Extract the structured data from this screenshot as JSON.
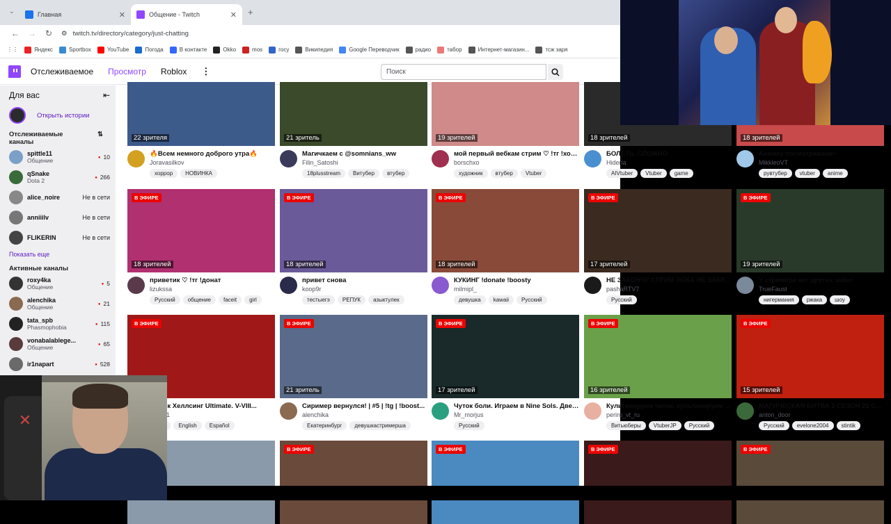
{
  "browser": {
    "tabs": [
      {
        "title": "Главная",
        "color": "#1a73e8"
      },
      {
        "title": "Общение - Twitch",
        "color": "#9146ff"
      }
    ],
    "url": "twitch.tv/directory/category/just-chatting",
    "bookmarks": [
      "Яндекс",
      "Sportbox",
      "YouTube",
      "Погода",
      "В контакте",
      "Okko",
      "mos",
      "госу",
      "Википедия",
      "Google Переводчик",
      "радио",
      "табор",
      "Интернет-магазин...",
      "тсж заря"
    ]
  },
  "topnav": {
    "following": "Отслеживаемое",
    "browse": "Просмотр",
    "roblox": "Roblox",
    "search_placeholder": "Поиск",
    "accent": "#9146ff"
  },
  "sidebar": {
    "for_you": "Для вас",
    "stories": "Открыть истории",
    "followed_title": "Отслеживаемые каналы",
    "followed": [
      {
        "name": "spittle11",
        "sub": "Общение",
        "viewers": "10",
        "color": "#7aa0c8"
      },
      {
        "name": "qSnake",
        "sub": "Dota 2",
        "viewers": "266",
        "color": "#3a6b3a"
      },
      {
        "name": "alice_noire",
        "sub": "",
        "viewers": "Не в сети",
        "color": "#888"
      },
      {
        "name": "anniiilv",
        "sub": "",
        "viewers": "Не в сети",
        "color": "#777"
      },
      {
        "name": "FLIKERIN",
        "sub": "",
        "viewers": "Не в сети",
        "color": "#444"
      }
    ],
    "show_more": "Показать еще",
    "active_title": "Активные каналы",
    "active": [
      {
        "name": "roxy4ka",
        "sub": "Общение",
        "viewers": "5",
        "color": "#333"
      },
      {
        "name": "alenchika",
        "sub": "Общение",
        "viewers": "21",
        "color": "#8a6a50"
      },
      {
        "name": "tata_spb",
        "sub": "Phasmophobia",
        "viewers": "115",
        "color": "#222"
      },
      {
        "name": "vonabalablege...",
        "sub": "Общение",
        "viewers": "65",
        "color": "#5a3a3a"
      },
      {
        "name": "ir1napart",
        "sub": "",
        "viewers": "528",
        "color": "#6a6a6a"
      }
    ]
  },
  "live_label": "В ЭФИРЕ",
  "streams": [
    {
      "viewers": "22 зрителя",
      "title": "🔥Всем немного доброго утра🔥",
      "channel": "Joravasilkov",
      "tags": [
        "хоррор",
        "НОВИНКА"
      ],
      "bg": "#3c5a8a",
      "av": "#d4a020",
      "live": false
    },
    {
      "viewers": "21 зритель",
      "title": "Магичкаем с @somnians_ww",
      "channel": "Filin_Satoshi",
      "tags": [
        "18plusstream",
        "Витубер",
        "втубер"
      ],
      "bg": "#3a4a2a",
      "av": "#3a3a5a",
      "live": false
    },
    {
      "viewers": "19 зрителей",
      "title": "мой первый вебкам стрим ♡ !тг !хор...",
      "channel": "borschxo",
      "tags": [
        "художник",
        "втубер",
        "Vtuber"
      ],
      "bg": "#d08a8a",
      "av": "#a03050",
      "live": false
    },
    {
      "viewers": "18 зрителей",
      "title": "БОЛЕТЬ..СЛОЖНО",
      "channel": "Hideria",
      "tags": [
        "AIVtuber",
        "Vtuber",
        "game"
      ],
      "bg": "#2a2a2a",
      "av": "#4a90d0",
      "live": false
    },
    {
      "viewers": "18 зрителей",
      "title": "Анимку посматриваем~",
      "channel": "MikkleoVT",
      "tags": [
        "рувтубер",
        "vtuber",
        "anime"
      ],
      "bg": "#c84a4a",
      "av": "#a0c8e8",
      "live": false
    },
    {
      "viewers": "18 зрителей",
      "title": "приветик ♡ !тг !донат",
      "channel": "lizukssa",
      "tags": [
        "Русский",
        "общение",
        "faceit",
        "girl"
      ],
      "bg": "#b03070",
      "av": "#5a3a4a",
      "live": true
    },
    {
      "viewers": "18 зрителей",
      "title": "привет снова",
      "channel": "koop9r",
      "tags": [
        "тестыегэ",
        "РЕПУК",
        "азыктулек"
      ],
      "bg": "#6a5a9a",
      "av": "#2a2a4a",
      "live": true
    },
    {
      "viewers": "18 зрителей",
      "title": "КУКИНГ !donate !boosty",
      "channel": "milmipl_",
      "tags": [
        "девушка",
        "kawaii",
        "Русский"
      ],
      "bg": "#8a4a3a",
      "av": "#8a5ad0",
      "live": true
    },
    {
      "viewers": "17 зрителей",
      "title": "НЕ ЗАКОНЧУ СТРИМ ПОКА НЕ ЗАКР...",
      "channel": "pashaRTV7",
      "tags": [
        "Русский"
      ],
      "bg": "#3a2a20",
      "av": "#1a1a1a",
      "live": true
    },
    {
      "viewers": "19 зрителей",
      "title": "У стримера нет других забот",
      "channel": "TrueFaust",
      "tags": [
        "нигермания",
        "ржака",
        "шоу"
      ],
      "bg": "#2a3a2a",
      "av": "#7a8a9a",
      "live": true
    },
    {
      "viewers": "",
      "title": "31 мск Хеллсинг Ultimate. V-VIII...",
      "channel": "lina031",
      "tags": [
        "ский",
        "English",
        "Español"
      ],
      "bg": "#a01818",
      "av": "#a01818",
      "live": true
    },
    {
      "viewers": "21 зритель",
      "title": "Сиример вернулся! | #5 | !tg | !boost...",
      "channel": "alenchika",
      "tags": [
        "Екатеринбург",
        "девушкастримерша"
      ],
      "bg": "#5a6a8a",
      "av": "#8a6a50",
      "live": true
    },
    {
      "viewers": "17 зрителей",
      "title": "Чуток боли. Играем в Nine Sols. Две ...",
      "channel": "Mr_morjus",
      "tags": [
        "Русский"
      ],
      "bg": "#1a2a2a",
      "av": "#2aa080",
      "live": true
    },
    {
      "viewers": "16 зрителей",
      "title": "Культивируем чатик, культивируем ...",
      "channel": "periru_vt_ru",
      "tags": [
        "Витьюберы",
        "VtuberJP",
        "Русский"
      ],
      "bg": "#6aa04a",
      "av": "#e8b0a0",
      "live": true
    },
    {
      "viewers": "15 зрителей",
      "title": "МАГИЧЕСКАЯ БИТВА 2 СЕЗОН 21 С...",
      "channel": "anton_door",
      "tags": [
        "Русский",
        "evelone2004",
        "stintik"
      ],
      "bg": "#c02010",
      "av": "#3a6a3a",
      "live": true
    },
    {
      "viewers": "",
      "title": "",
      "channel": "",
      "tags": [],
      "bg": "#8a9aaa",
      "av": "#888",
      "live": false
    },
    {
      "viewers": "",
      "title": "",
      "channel": "",
      "tags": [],
      "bg": "#6a4a3a",
      "av": "#888",
      "live": true
    },
    {
      "viewers": "",
      "title": "",
      "channel": "",
      "tags": [],
      "bg": "#4a8ac0",
      "av": "#888",
      "live": true
    },
    {
      "viewers": "",
      "title": "",
      "channel": "",
      "tags": [],
      "bg": "#3a1a1a",
      "av": "#888",
      "live": true
    },
    {
      "viewers": "",
      "title": "",
      "channel": "",
      "tags": [],
      "bg": "#5a4a3a",
      "av": "#888",
      "live": true
    }
  ]
}
